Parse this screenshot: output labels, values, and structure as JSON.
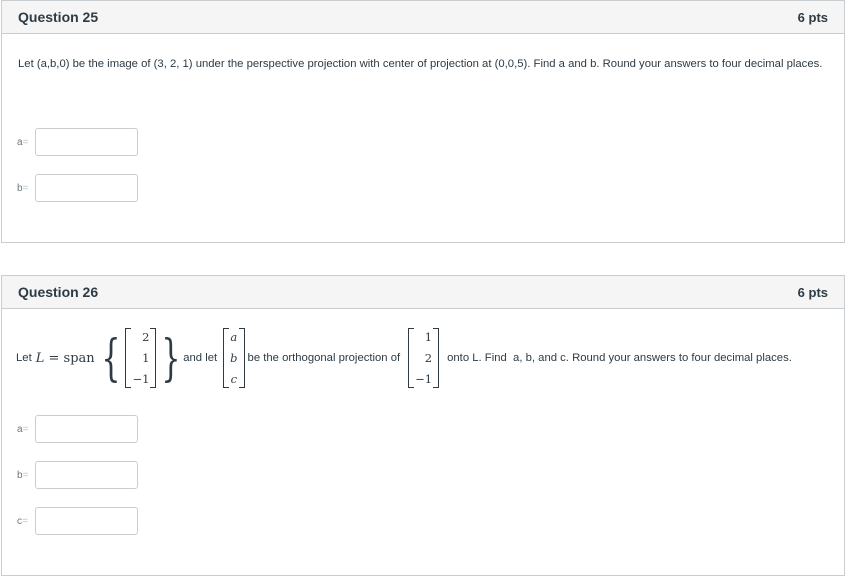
{
  "questions": [
    {
      "title": "Question 25",
      "points": "6 pts",
      "text": "Let (a,b,0) be the image of (3, 2, 1) under the perspective projection with center of projection at (0,0,5). Find a and b.  Round your answers to four decimal places.",
      "answers": [
        {
          "label": "a",
          "eq": "=",
          "value": "",
          "placeholder": ""
        },
        {
          "label": "b",
          "eq": "=",
          "value": "",
          "placeholder": ""
        }
      ]
    },
    {
      "title": "Question 26",
      "points": "6 pts",
      "text_parts": {
        "let": "Let",
        "L": "L",
        "equals": " = ",
        "span": "span",
        "span_vector": [
          "2",
          "1",
          "−1"
        ],
        "and_let": "and let",
        "var_vector": [
          "a",
          "b",
          "c"
        ],
        "be_proj": "be the orthogonal projection of",
        "proj_vector": [
          "1",
          "2",
          "−1"
        ],
        "tail": "onto L. Find  a, b, and c. Round your answers to four decimal places."
      },
      "answers": [
        {
          "label": "a",
          "eq": "=",
          "value": "",
          "placeholder": ""
        },
        {
          "label": "b",
          "eq": "=",
          "value": "",
          "placeholder": ""
        },
        {
          "label": "c",
          "eq": "=",
          "value": "",
          "placeholder": ""
        }
      ]
    }
  ]
}
